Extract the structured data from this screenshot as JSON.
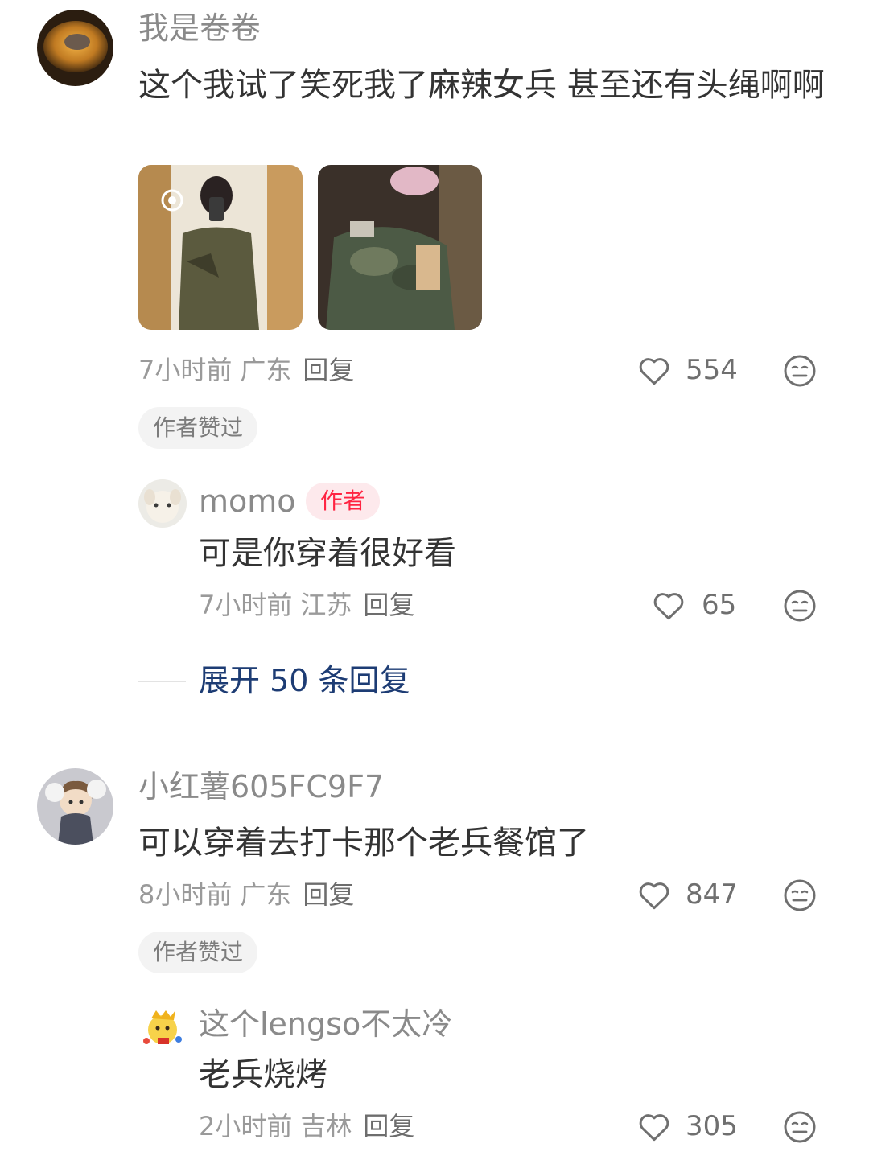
{
  "comments": [
    {
      "username": "我是卷卷",
      "text": "这个我试了笑死我了麻辣女兵 甚至还有头绳啊啊",
      "time": "7小时前",
      "location": "广东",
      "reply_label": "回复",
      "likes": "554",
      "badge": "作者赞过",
      "reply": {
        "username": "momo",
        "author_tag": "作者",
        "text": "可是你穿着很好看",
        "time": "7小时前",
        "location": "江苏",
        "reply_label": "回复",
        "likes": "65"
      },
      "expand_label": "展开 50 条回复"
    },
    {
      "username": "小红薯605FC9F7",
      "text": "可以穿着去打卡那个老兵餐馆了",
      "time": "8小时前",
      "location": "广东",
      "reply_label": "回复",
      "likes": "847",
      "badge": "作者赞过",
      "reply": {
        "username": "这个lengso不太冷",
        "text": "老兵烧烤",
        "time": "2小时前",
        "location": "吉林",
        "reply_label": "回复",
        "likes": "305"
      }
    }
  ],
  "icons": {
    "like": "heart-outline-icon",
    "emoji": "neutral-face-icon"
  },
  "colors": {
    "author_red": "#ff2442",
    "expand_blue": "#1d3c74",
    "muted_gray": "#9a9a9a"
  }
}
